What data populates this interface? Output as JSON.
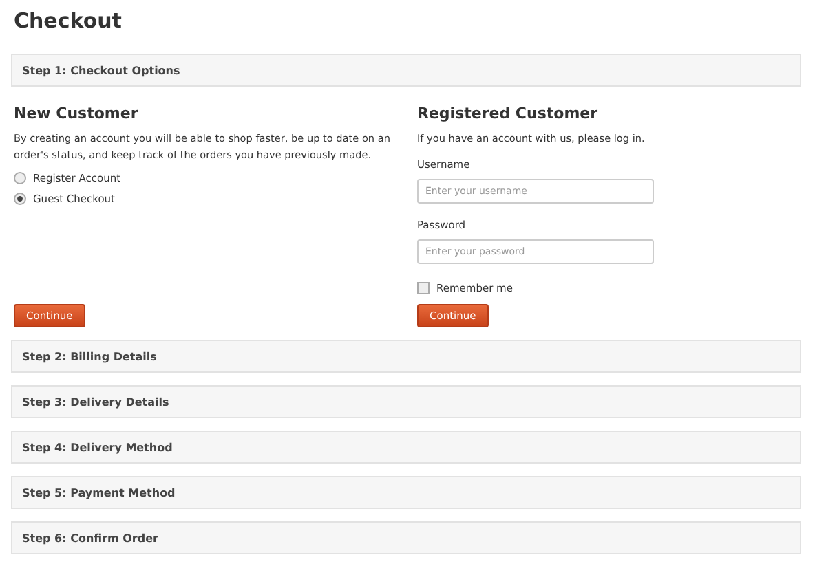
{
  "title": "Checkout",
  "steps": [
    {
      "label": "Step 1: Checkout Options",
      "new_customer": {
        "heading": "New Customer",
        "text": "By creating an account you will be able to shop faster, be up to date on an order's status, and keep track of the orders you have previously made.",
        "options": [
          {
            "label": "Register Account",
            "selected": false
          },
          {
            "label": "Guest Checkout",
            "selected": true
          }
        ],
        "button": "Continue"
      },
      "registered_customer": {
        "heading": "Registered Customer",
        "text": "If you have an account with us, please log in.",
        "fields": [
          {
            "label": "Username",
            "placeholder": "Enter your username"
          },
          {
            "label": "Password",
            "placeholder": "Enter your password"
          }
        ],
        "remember": {
          "label": "Remember me",
          "checked": false
        },
        "button": "Continue"
      }
    },
    {
      "label": "Step 2: Billing Details"
    },
    {
      "label": "Step 3: Delivery Details"
    },
    {
      "label": "Step 4: Delivery Method"
    },
    {
      "label": "Step 5: Payment Method"
    },
    {
      "label": "Step 6: Confirm Order"
    }
  ]
}
